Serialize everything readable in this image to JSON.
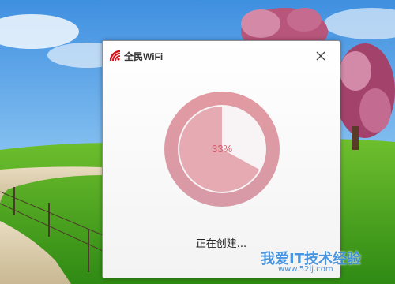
{
  "dialog": {
    "title": "全民WiFi",
    "progress_percent": 33,
    "progress_label": "33%",
    "status": "正在创建...",
    "accent": "#d2141e",
    "ring_color": "#e0a0a8"
  },
  "watermark": {
    "text": "我爱IT技术经验",
    "url": "www.52ij.com"
  },
  "icons": [
    "wifi-logo-icon",
    "close-icon"
  ]
}
